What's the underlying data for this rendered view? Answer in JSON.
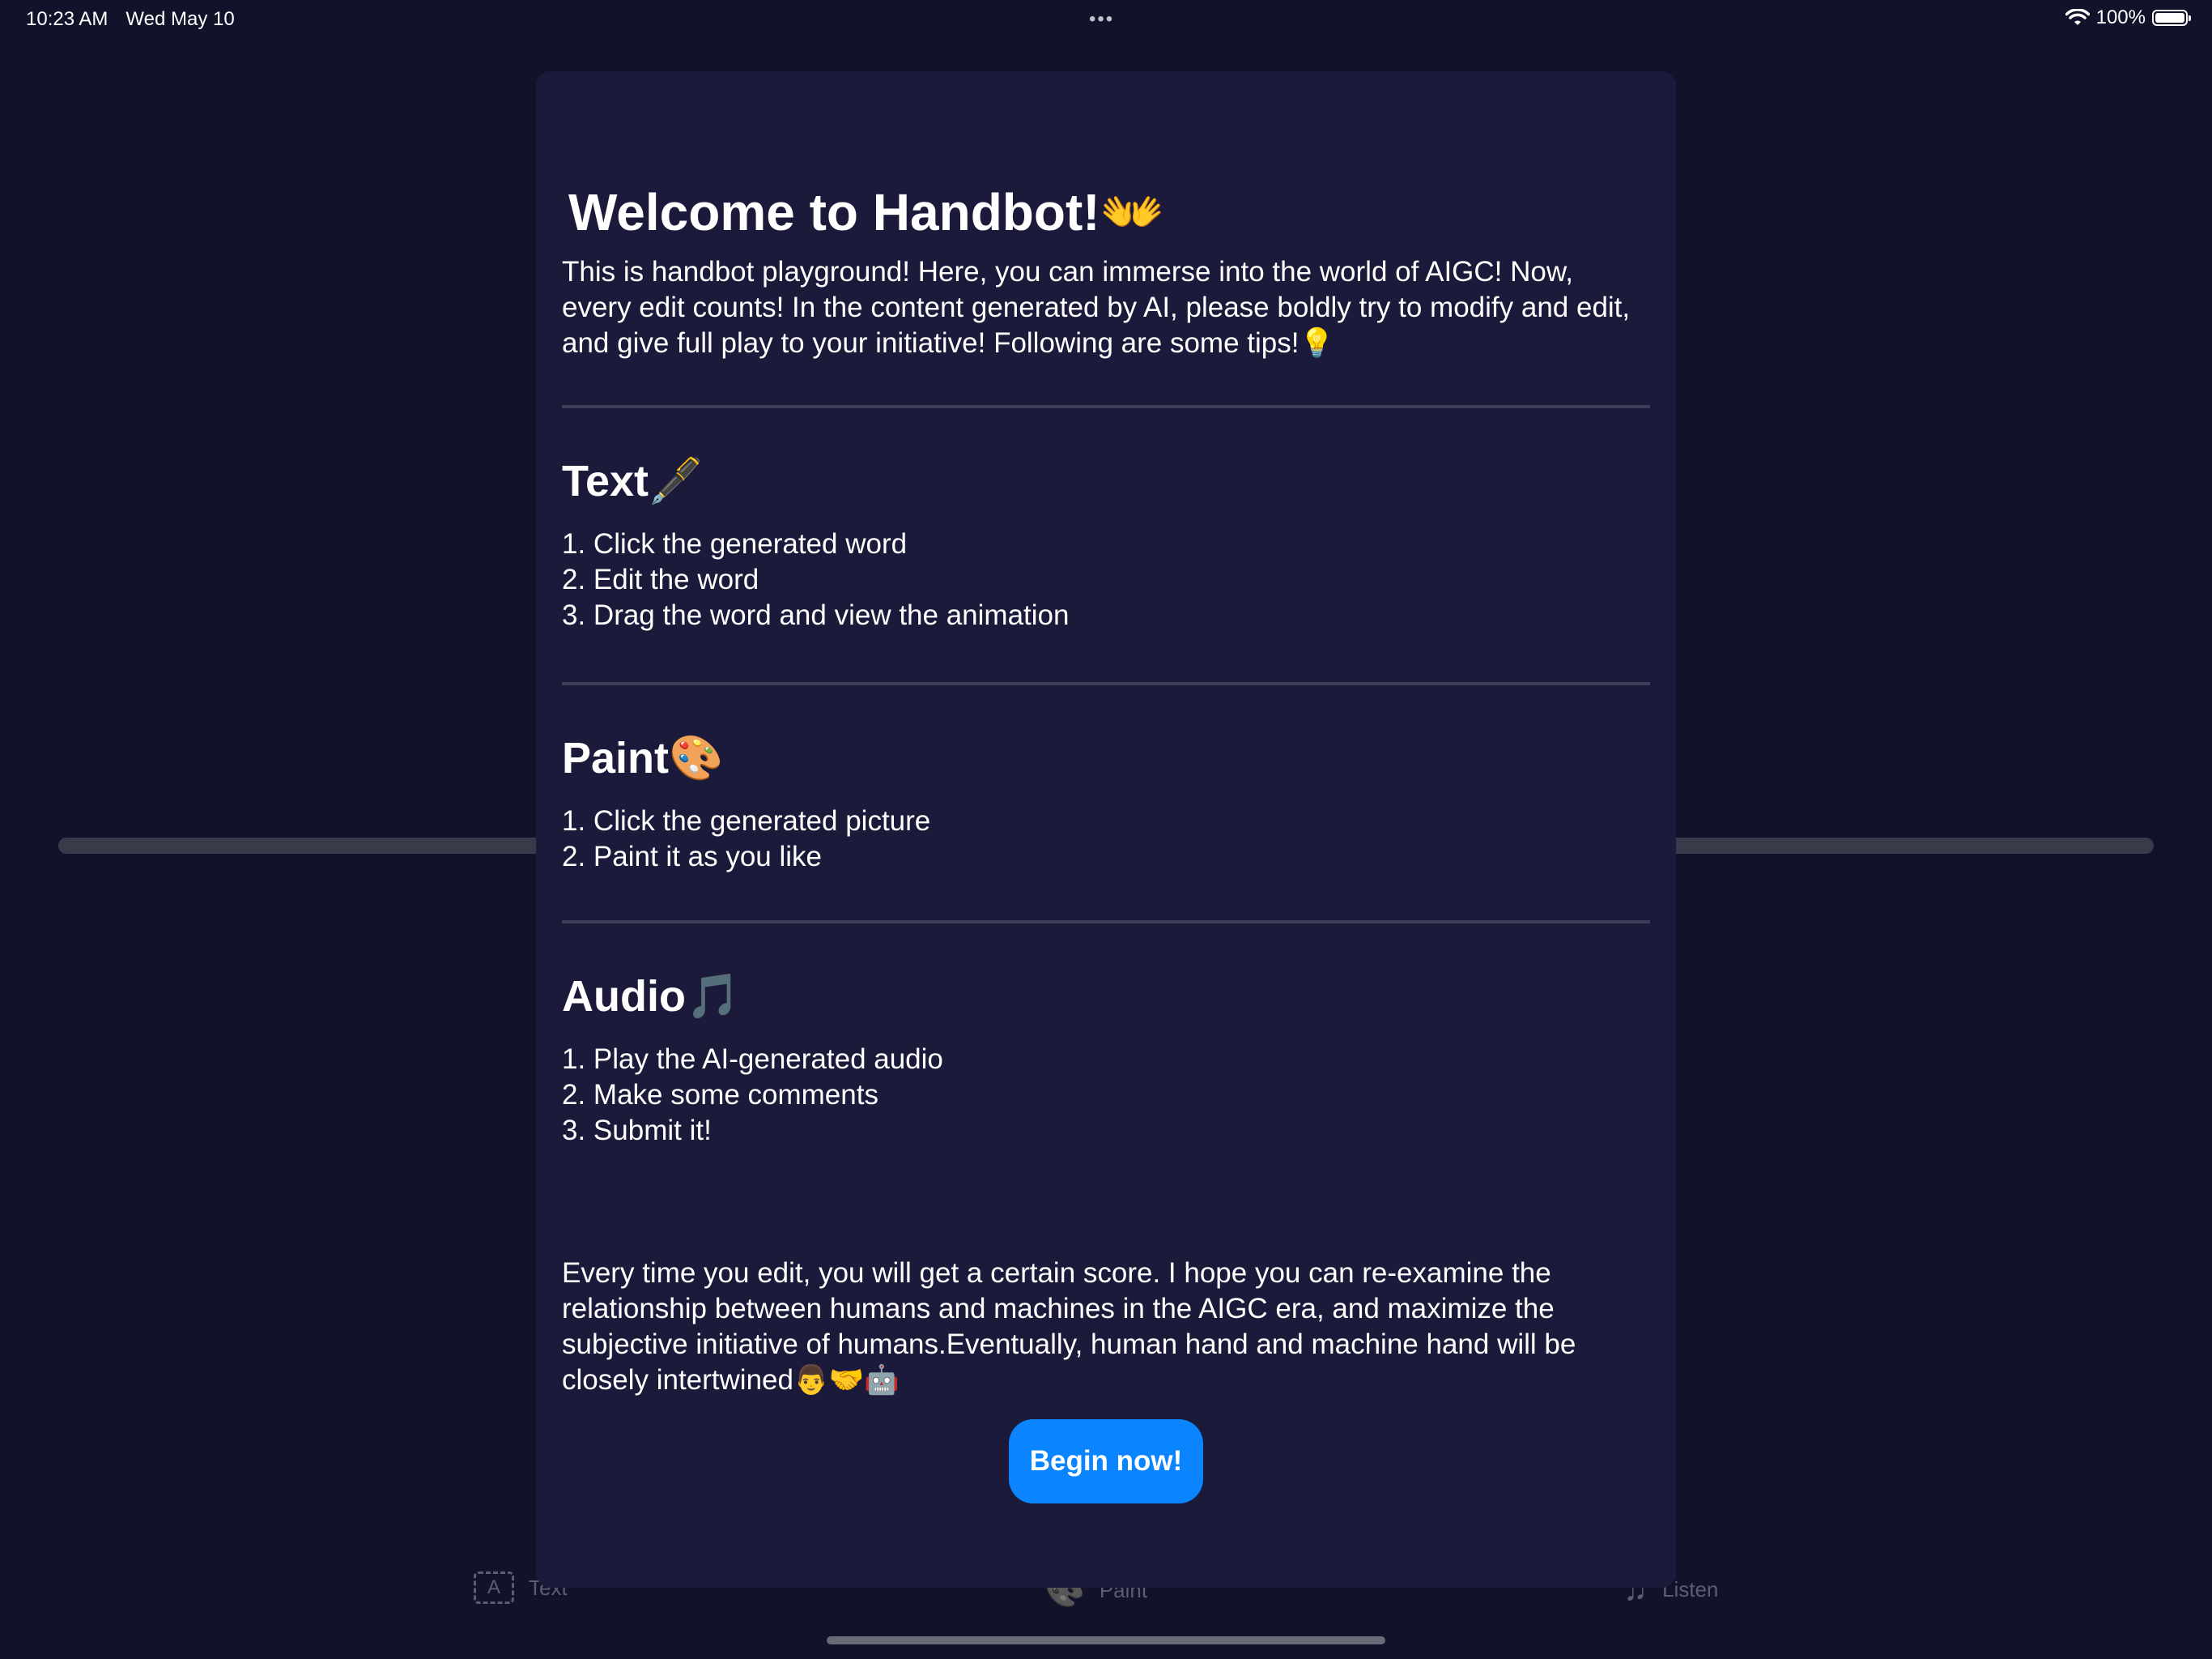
{
  "status_bar": {
    "time": "10:23 AM",
    "date": "Wed May 10",
    "more_dots": "•••",
    "battery_percent": "100%",
    "battery_level": 1.0,
    "icons": [
      "wifi-icon",
      "battery-icon"
    ]
  },
  "tab_bar": {
    "tabs": [
      {
        "label": "Text",
        "icon": "text-icon",
        "icon_glyph": "A"
      },
      {
        "label": "Paint",
        "icon": "palette-icon",
        "icon_glyph": "🎨"
      },
      {
        "label": "Listen",
        "icon": "music-notes-icon",
        "icon_glyph": "♫"
      }
    ]
  },
  "modal": {
    "title": "Welcome to Handbot!👐",
    "intro": "This is handbot playground! Here, you can immerse into the world of AIGC! Now, every edit counts! In the content generated by AI, please boldly try to modify and edit, and give full play to your initiative! Following are some tips!💡",
    "sections": [
      {
        "title": "Text🖋️",
        "steps": [
          "1. Click the generated word",
          "2. Edit the word",
          "3. Drag the word and view the animation"
        ]
      },
      {
        "title": "Paint🎨",
        "steps": [
          "1. Click the generated picture",
          "2. Paint it as you like"
        ]
      },
      {
        "title": "Audio🎵",
        "steps": [
          "1. Play the AI-generated audio",
          "2. Make some comments",
          "3. Submit it!"
        ]
      }
    ],
    "outro": "Every time you edit, you will get a certain score. I hope you can re-examine the relationship between humans and machines in the AIGC era, and maximize the subjective initiative of humans.Eventually, human hand and machine hand will be closely intertwined👨🤝🤖",
    "begin_button": "Begin now!"
  },
  "colors": {
    "background": "#12132a",
    "sheet": "#1b1a3a",
    "accent": "#0a84ff",
    "divider": "#3a3c58",
    "inactive_tab": "#5c5e70"
  }
}
